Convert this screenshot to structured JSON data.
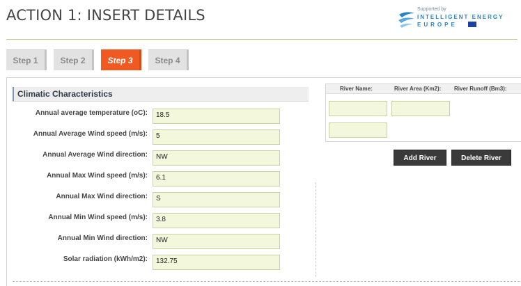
{
  "header": {
    "title": "ACTION 1: INSERT DETAILS",
    "logo": {
      "supported": "Supported by",
      "line1": "INTELLIGENT ENERGY",
      "line2": "EUROPE"
    }
  },
  "tabs": [
    {
      "label": "Step 1",
      "active": false
    },
    {
      "label": "Step 2",
      "active": false
    },
    {
      "label": "Step 3",
      "active": true
    },
    {
      "label": "Step 4",
      "active": false
    }
  ],
  "climatic": {
    "section_title": "Climatic Characteristics",
    "fields": [
      {
        "label": "Annual average temperature (oC):",
        "value": "18.5"
      },
      {
        "label": "Annual Average Wind speed (m/s):",
        "value": "5"
      },
      {
        "label": "Annual Average Wind direction:",
        "value": "NW"
      },
      {
        "label": "Annual Max Wind speed (m/s):",
        "value": "6.1"
      },
      {
        "label": "Annual Max Wind direction:",
        "value": "S"
      },
      {
        "label": "Annual Min Wind speed (m/s):",
        "value": "3.8"
      },
      {
        "label": "Annual Min Wind direction:",
        "value": "NW"
      },
      {
        "label": "Solar radiation (kWh/m2):",
        "value": "132.75"
      }
    ]
  },
  "rivers": {
    "columns": [
      "River Name:",
      "River Area (Km2):",
      "River Runoff (Bm3):"
    ],
    "add_label": "Add River",
    "delete_label": "Delete River"
  },
  "colors": {
    "accent_active_tab": "#f05a22",
    "input_bg": "#f3f7dc",
    "header_rule": "#b7c98a"
  }
}
